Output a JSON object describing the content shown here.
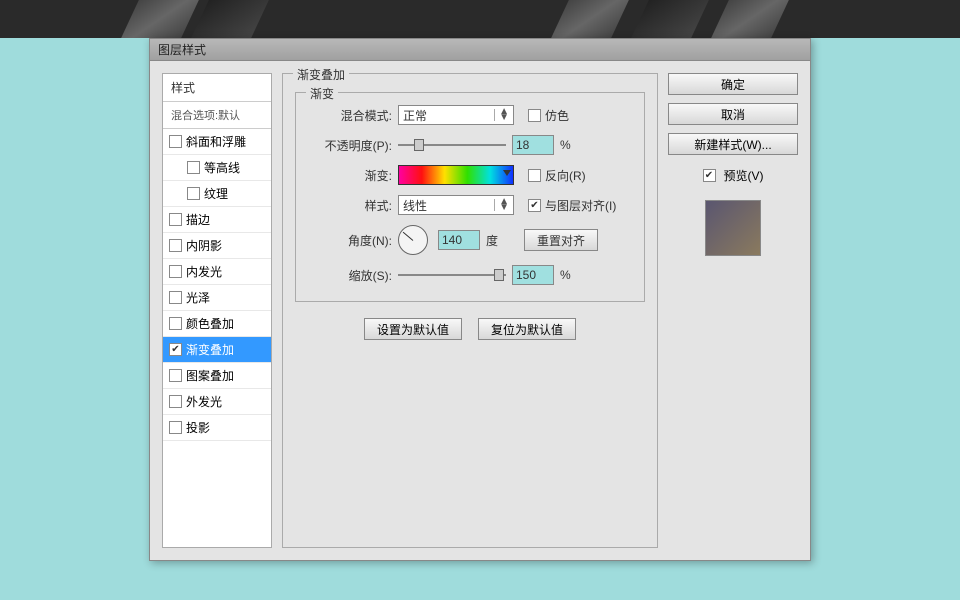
{
  "background_color": "#9fdcdc",
  "dialog": {
    "title": "图层样式"
  },
  "left_panel": {
    "header": "样式",
    "sub": "混合选项:默认",
    "items": [
      {
        "label": "斜面和浮雕",
        "indent": false,
        "checked": false,
        "selected": false
      },
      {
        "label": "等高线",
        "indent": true,
        "checked": false,
        "selected": false
      },
      {
        "label": "纹理",
        "indent": true,
        "checked": false,
        "selected": false
      },
      {
        "label": "描边",
        "indent": false,
        "checked": false,
        "selected": false
      },
      {
        "label": "内阴影",
        "indent": false,
        "checked": false,
        "selected": false
      },
      {
        "label": "内发光",
        "indent": false,
        "checked": false,
        "selected": false
      },
      {
        "label": "光泽",
        "indent": false,
        "checked": false,
        "selected": false
      },
      {
        "label": "颜色叠加",
        "indent": false,
        "checked": false,
        "selected": false
      },
      {
        "label": "渐变叠加",
        "indent": false,
        "checked": true,
        "selected": true
      },
      {
        "label": "图案叠加",
        "indent": false,
        "checked": false,
        "selected": false
      },
      {
        "label": "外发光",
        "indent": false,
        "checked": false,
        "selected": false
      },
      {
        "label": "投影",
        "indent": false,
        "checked": false,
        "selected": false
      }
    ]
  },
  "center": {
    "group_title": "渐变叠加",
    "subgroup_title": "渐变",
    "blend_mode_label": "混合模式:",
    "blend_mode_value": "正常",
    "dither_label": "仿色",
    "opacity_label": "不透明度(P):",
    "opacity_value": "18",
    "pct": "%",
    "gradient_label": "渐变:",
    "reverse_label": "反向(R)",
    "style_label": "样式:",
    "style_value": "线性",
    "align_label": "与图层对齐(I)",
    "align_checked": true,
    "angle_label": "角度(N):",
    "angle_value": "140",
    "degree": "度",
    "reset_align": "重置对齐",
    "scale_label": "缩放(S):",
    "scale_value": "150",
    "btn_default": "设置为默认值",
    "btn_reset": "复位为默认值"
  },
  "right": {
    "ok": "确定",
    "cancel": "取消",
    "new_style": "新建样式(W)...",
    "preview_label": "预览(V)",
    "preview_checked": true
  }
}
